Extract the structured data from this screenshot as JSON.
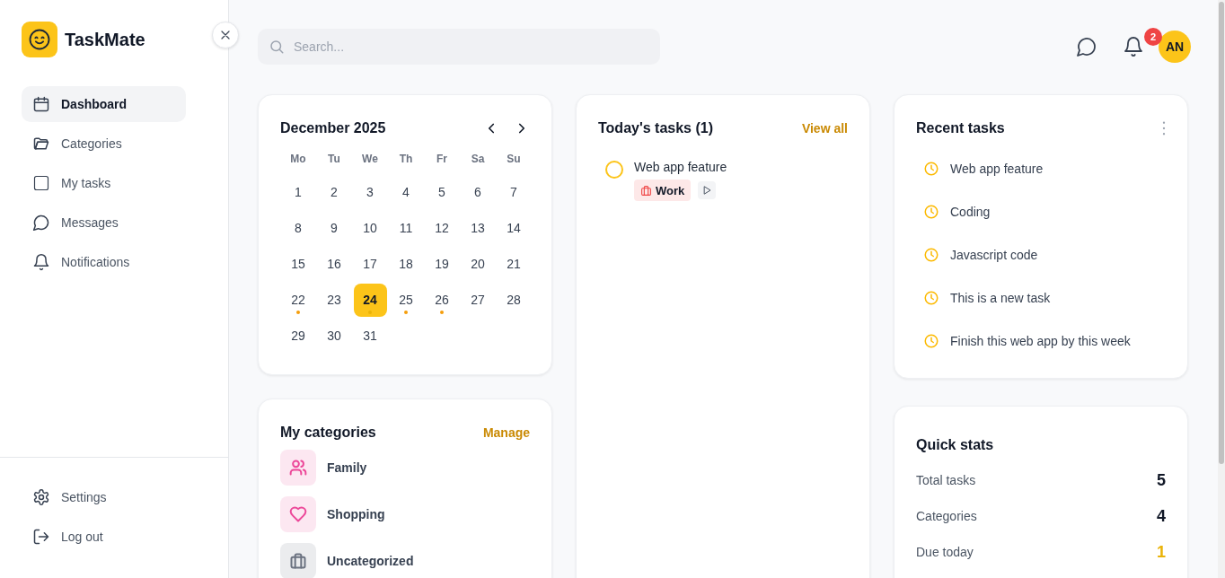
{
  "app": {
    "name": "TaskMate"
  },
  "sidebar": {
    "items": [
      {
        "label": "Dashboard",
        "selected": true
      },
      {
        "label": "Categories",
        "selected": false
      },
      {
        "label": "My tasks",
        "selected": false
      },
      {
        "label": "Messages",
        "selected": false
      },
      {
        "label": "Notifications",
        "selected": false
      }
    ],
    "footer_items": [
      {
        "label": "Settings"
      },
      {
        "label": "Log out"
      }
    ]
  },
  "topbar": {
    "search": {
      "placeholder": "Search..."
    },
    "notification_count": "2",
    "avatar": "AN"
  },
  "calendar": {
    "title": "December 2025",
    "weekdays": [
      "Mo",
      "Tu",
      "We",
      "Th",
      "Fr",
      "Sa",
      "Su"
    ],
    "days": [
      {
        "label": "1",
        "selected": false,
        "has_tasks": false
      },
      {
        "label": "2",
        "selected": false,
        "has_tasks": false
      },
      {
        "label": "3",
        "selected": false,
        "has_tasks": false
      },
      {
        "label": "4",
        "selected": false,
        "has_tasks": false
      },
      {
        "label": "5",
        "selected": false,
        "has_tasks": false
      },
      {
        "label": "6",
        "selected": false,
        "has_tasks": false
      },
      {
        "label": "7",
        "selected": false,
        "has_tasks": false
      },
      {
        "label": "8",
        "selected": false,
        "has_tasks": false
      },
      {
        "label": "9",
        "selected": false,
        "has_tasks": false
      },
      {
        "label": "10",
        "selected": false,
        "has_tasks": false
      },
      {
        "label": "11",
        "selected": false,
        "has_tasks": false
      },
      {
        "label": "12",
        "selected": false,
        "has_tasks": false
      },
      {
        "label": "13",
        "selected": false,
        "has_tasks": false
      },
      {
        "label": "14",
        "selected": false,
        "has_tasks": false
      },
      {
        "label": "15",
        "selected": false,
        "has_tasks": false
      },
      {
        "label": "16",
        "selected": false,
        "has_tasks": false
      },
      {
        "label": "17",
        "selected": false,
        "has_tasks": false
      },
      {
        "label": "18",
        "selected": false,
        "has_tasks": false
      },
      {
        "label": "19",
        "selected": false,
        "has_tasks": false
      },
      {
        "label": "20",
        "selected": false,
        "has_tasks": false
      },
      {
        "label": "21",
        "selected": false,
        "has_tasks": false
      },
      {
        "label": "22",
        "selected": false,
        "has_tasks": true
      },
      {
        "label": "23",
        "selected": false,
        "has_tasks": false
      },
      {
        "label": "24",
        "selected": true,
        "has_tasks": true
      },
      {
        "label": "25",
        "selected": false,
        "has_tasks": true
      },
      {
        "label": "26",
        "selected": false,
        "has_tasks": true
      },
      {
        "label": "27",
        "selected": false,
        "has_tasks": false
      },
      {
        "label": "28",
        "selected": false,
        "has_tasks": false
      },
      {
        "label": "29",
        "selected": false,
        "has_tasks": false
      },
      {
        "label": "30",
        "selected": false,
        "has_tasks": false
      },
      {
        "label": "31",
        "selected": false,
        "has_tasks": false
      }
    ]
  },
  "categories": {
    "title": "My categories",
    "action": "Manage",
    "items": [
      {
        "name": "Family",
        "kind": "people",
        "color": "#ec4899"
      },
      {
        "name": "Shopping",
        "kind": "heart",
        "color": "#ec4899"
      },
      {
        "name": "Uncategorized",
        "kind": "briefcase",
        "color": "#6b7280"
      }
    ]
  },
  "todays_tasks": {
    "title": "Today's tasks (1)",
    "action": "View all",
    "tasks": [
      {
        "title": "Web app feature",
        "done": false,
        "tag": {
          "label": "Work",
          "color": "#ef4444"
        }
      }
    ]
  },
  "recent_tasks": {
    "title": "Recent tasks",
    "items": [
      "Web app feature",
      "Coding",
      "Javascript code",
      "This is a new task",
      "Finish this web app by this week"
    ]
  },
  "quick_stats": {
    "title": "Quick stats",
    "items": [
      {
        "label": "Total tasks",
        "value": "5",
        "highlight": false
      },
      {
        "label": "Categories",
        "value": "4",
        "highlight": false
      },
      {
        "label": "Due today",
        "value": "1",
        "highlight": true
      }
    ]
  }
}
